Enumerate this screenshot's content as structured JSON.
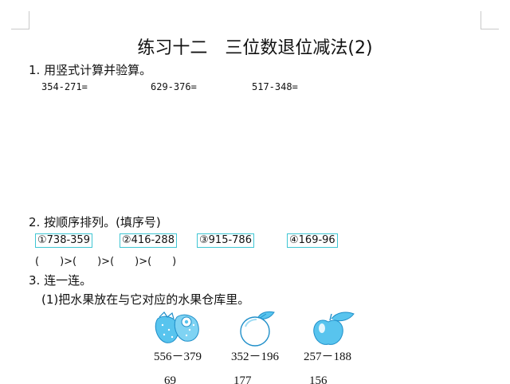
{
  "title": "练习十二　三位数退位减法(2)",
  "section1": {
    "heading": "1. 用竖式计算并验算。",
    "problems": [
      "354-271=",
      "629-376=",
      "517-348="
    ]
  },
  "section2": {
    "heading": "2. 按顺序排列。(填序号)",
    "items": [
      "①738-359",
      "②416-288",
      "③915-786",
      "④169-96"
    ],
    "order_row": "(　　)>(　　)>(　　)>(　　)"
  },
  "section3": {
    "heading": "3. 连一连。",
    "subheading": "(1)把水果放在与它对应的水果仓库里。",
    "fruits": [
      {
        "icon": "strawberry-icon",
        "expression": "556－379"
      },
      {
        "icon": "orange-icon",
        "expression": "352－196"
      },
      {
        "icon": "apple-icon",
        "expression": "257－188"
      }
    ],
    "warehouse_numbers": [
      "69",
      "177",
      "156"
    ]
  },
  "colors": {
    "box_border": "#3fc6d3",
    "fruit_fill": "#58c4ee",
    "fruit_stroke": "#1f8fc9"
  }
}
